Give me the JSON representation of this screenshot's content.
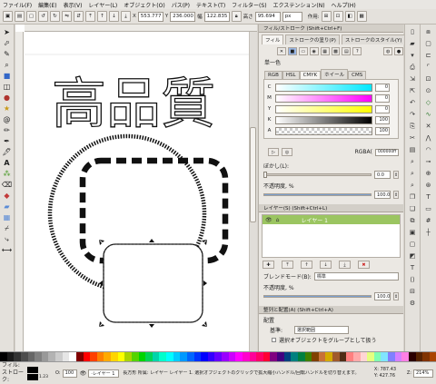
{
  "menu": [
    "ファイル(F)",
    "編集(E)",
    "表示(V)",
    "レイヤー(L)",
    "オブジェクト(O)",
    "パス(P)",
    "テキスト(T)",
    "フィルター(S)",
    "エクステンション(N)",
    "ヘルプ(H)"
  ],
  "controls": {
    "x_label": "X",
    "x_value": "553.777",
    "y_label": "Y",
    "y_value": "236.000",
    "w_label": "幅",
    "w_value": "122.835",
    "h_label": "高さ",
    "h_value": "95.694",
    "unit": "px",
    "affect_label": "作用:"
  },
  "canvas": {
    "headline": "高品質"
  },
  "fill_panel": {
    "title": "フィル/ストローク (Shift+Ctrl+F)",
    "tabs": [
      "フィル",
      "ストロークの塗り(P)",
      "ストロークのスタイル(Y)"
    ],
    "flat_label": "単一色",
    "mode_tabs": [
      "RGB",
      "HSL",
      "CMYK",
      "ホイール",
      "CMS"
    ],
    "channels": [
      {
        "label": "C",
        "value": "0",
        "gradient": "linear-gradient(to right,#ffffff,#00e8ff)"
      },
      {
        "label": "M",
        "value": "0",
        "gradient": "linear-gradient(to right,#ffffff,#ff00ff)"
      },
      {
        "label": "Y",
        "value": "0",
        "gradient": "linear-gradient(to right,#ffffff,#ffff00)"
      },
      {
        "label": "K",
        "value": "100",
        "gradient": "linear-gradient(to right,#ffffff,#000000)"
      },
      {
        "label": "A",
        "value": "100",
        "gradient": "linear-gradient(to right,#ffffff,#000000)"
      }
    ],
    "rgba_label": "RGBA(",
    "rgba_value": "000000ff",
    "blur_label": "ぼかし(L):",
    "blur_value": "0.0",
    "opacity_label": "不透明度, %",
    "opacity_value": "100.0"
  },
  "layers_panel": {
    "title": "レイヤー(S) (Shift+Ctrl+L)",
    "layer_name": "レイヤー 1",
    "blend_label": "ブレンドモード(B):",
    "blend_value": "標準",
    "opacity_label": "不透明度, %",
    "opacity_value": "100.0"
  },
  "align_panel": {
    "title": "整列と配置(A) (Shift+Ctrl+A)",
    "section_label": "配置",
    "relative_label": "基準:",
    "relative_value": "選択範囲",
    "group_label": "選択オブジェクトをグループとして扱う"
  },
  "status": {
    "fill_label": "フィル:",
    "stroke_label": "ストローク:",
    "stroke_width": "1.23",
    "opacity_value": "100",
    "layer_value": "·レイヤー 1",
    "message": "長方形 所属: レイヤー レイヤー 1. 選択オブジェクトのクリックで拡大縮小ハンドル/回転ハンドルを切り替えます。",
    "x_readout": "X:  787.43",
    "y_readout": "Y:  427.76",
    "zoom_label": "Z:",
    "zoom_value": "214%"
  },
  "palette_colors": [
    "#000000",
    "#1a1a1a",
    "#333333",
    "#4d4d4d",
    "#666666",
    "#808080",
    "#999999",
    "#b3b3b3",
    "#cccccc",
    "#e6e6e6",
    "#ffffff",
    "#800000",
    "#ff0000",
    "#ff4000",
    "#ff8000",
    "#ffaa00",
    "#ffd500",
    "#ffff00",
    "#aad400",
    "#55d400",
    "#00d400",
    "#00d455",
    "#00d4aa",
    "#00ffcc",
    "#00ffff",
    "#00ccff",
    "#0099ff",
    "#0066ff",
    "#0033ff",
    "#0000ff",
    "#3300ff",
    "#6600ff",
    "#9900ff",
    "#cc00ff",
    "#ff00ff",
    "#ff00cc",
    "#ff0099",
    "#ff0066",
    "#ff0033",
    "#800080",
    "#400080",
    "#004080",
    "#008080",
    "#008040",
    "#408000",
    "#804000",
    "#c87137",
    "#d4aa00",
    "#a05a2c",
    "#502d16",
    "#ff8080",
    "#ffaaaa",
    "#ffd5d5",
    "#e5ff80",
    "#80ffb3",
    "#80e5ff",
    "#8080ff",
    "#d580ff",
    "#ff80e5",
    "#2b0000",
    "#552200",
    "#803300",
    "#aa4400"
  ]
}
